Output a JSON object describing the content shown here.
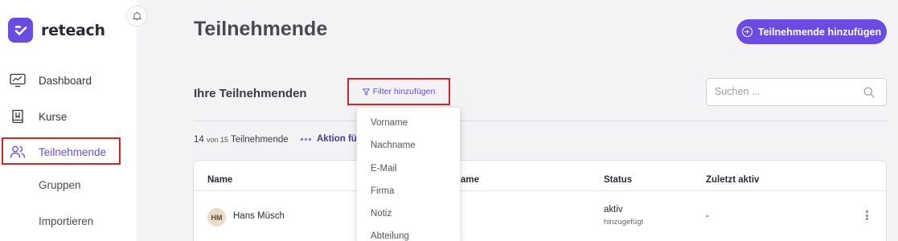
{
  "brand": {
    "name": "reteach",
    "accent": "#6a4ce0"
  },
  "sidebar": {
    "items": [
      {
        "label": "Dashboard",
        "icon": "dashboard-monitor-icon"
      },
      {
        "label": "Kurse",
        "icon": "book-icon"
      },
      {
        "label": "Teilnehmende",
        "icon": "users-icon",
        "active": true
      },
      {
        "label": "Gruppen"
      },
      {
        "label": "Importieren"
      }
    ]
  },
  "header": {
    "title": "Teilnehmende",
    "add_button": "Teilnehmende hinzufügen"
  },
  "toolbar": {
    "section_title": "Ihre Teilnehmenden",
    "filter_button": "Filter hinzufügen",
    "search_placeholder": "Suchen ..."
  },
  "summary": {
    "shown": "14",
    "of": "von 15",
    "label": "Teilnehmende",
    "action_link": "Aktion fü"
  },
  "filter_menu": {
    "options": [
      "Vorname",
      "Nachname",
      "E-Mail",
      "Firma",
      "Notiz",
      "Abteilung"
    ]
  },
  "table": {
    "headers": {
      "name": "Name",
      "col2_fragment": "ame",
      "status": "Status",
      "last_active": "Zuletzt aktiv"
    },
    "rows": [
      {
        "initials": "HM",
        "name": "Hans Müsch",
        "status": "aktiv",
        "status_sub": "hinzugefügt",
        "last_active": "-"
      }
    ]
  }
}
